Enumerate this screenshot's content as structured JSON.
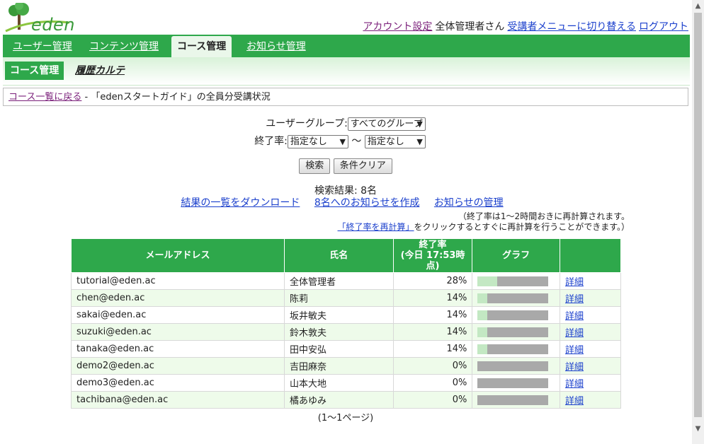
{
  "logo": {
    "text": "eden"
  },
  "account": {
    "settings_link": "アカウント設定",
    "user_name": "全体管理者さん",
    "switch_link": "受講者メニューに切り替える",
    "logout_link": "ログアウト"
  },
  "topnav": {
    "tabs": [
      {
        "label": "ユーザー管理"
      },
      {
        "label": "コンテンツ管理"
      },
      {
        "label": "コース管理"
      },
      {
        "label": "お知らせ管理"
      }
    ]
  },
  "subnav": {
    "active": "コース管理",
    "link": "履歴カルテ"
  },
  "breadcrumb": {
    "back_link": "コース一覧に戻る",
    "current": " - 「edenスタートガイド」の全員分受講状況"
  },
  "filters": {
    "group_label": "ユーザーグループ:",
    "group_value": "すべてのグループ",
    "rate_label": "終了率:",
    "rate_from": "指定なし",
    "rate_sep": "〜",
    "rate_to": "指定なし",
    "search_button": "検索",
    "clear_button": "条件クリア"
  },
  "results": {
    "summary": "検索結果: 8名",
    "download_link": "結果の一覧をダウンロード",
    "notify_link": "8名へのお知らせを作成",
    "manage_link": "お知らせの管理",
    "note_line1": "（終了率は1〜2時間おきに再計算されます。",
    "recalc_link": "「終了率を再計算」",
    "note_line2": "をクリックするとすぐに再計算を行うことができます。）"
  },
  "table": {
    "headers": {
      "email": "メールアドレス",
      "name": "氏名",
      "rate": "終了率",
      "rate_sub": "(今日 17:53時点)",
      "graph": "グラフ"
    },
    "detail_label": "詳細",
    "rows": [
      {
        "email": "tutorial@eden.ac",
        "name": "全体管理者",
        "rate": "28%",
        "pct": 28
      },
      {
        "email": "chen@eden.ac",
        "name": "陈莉",
        "rate": "14%",
        "pct": 14
      },
      {
        "email": "sakai@eden.ac",
        "name": "坂井敏夫",
        "rate": "14%",
        "pct": 14
      },
      {
        "email": "suzuki@eden.ac",
        "name": "鈴木敦夫",
        "rate": "14%",
        "pct": 14
      },
      {
        "email": "tanaka@eden.ac",
        "name": "田中安弘",
        "rate": "14%",
        "pct": 14
      },
      {
        "email": "demo2@eden.ac",
        "name": "吉田麻奈",
        "rate": "0%",
        "pct": 0
      },
      {
        "email": "demo3@eden.ac",
        "name": "山本大地",
        "rate": "0%",
        "pct": 0
      },
      {
        "email": "tachibana@eden.ac",
        "name": "橘あゆみ",
        "rate": "0%",
        "pct": 0
      }
    ]
  },
  "pager": {
    "text": "(1〜1ページ)"
  },
  "colors": {
    "brand_green": "#2ea84b",
    "row_alt": "#eefbea",
    "bar_fill": "#c3e8c3",
    "bar_bg": "#a9a9a9"
  }
}
